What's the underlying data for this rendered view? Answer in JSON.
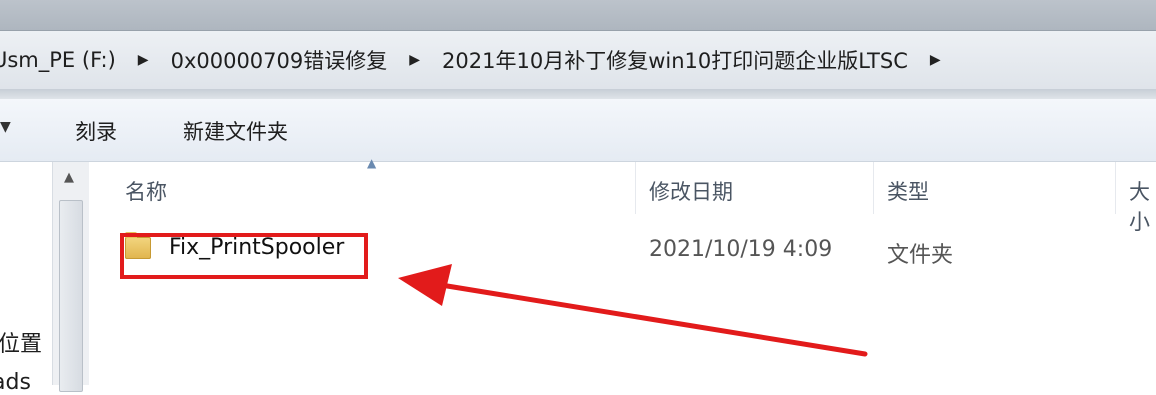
{
  "address_bar": {
    "crumbs": [
      "Usm_PE (F:)",
      "0x00000709错误修复",
      "2021年10月补丁修复win10打印问题企业版LTSC"
    ],
    "separator": "▶"
  },
  "toolbar": {
    "burn_label": "刻录",
    "new_folder_label": "新建文件夹"
  },
  "nav_pane": {
    "items": [
      "位置",
      "ads"
    ]
  },
  "columns": {
    "name": "名称",
    "date_modified": "修改日期",
    "type": "类型",
    "size": "大小"
  },
  "files": [
    {
      "name": "Fix_PrintSpooler",
      "date_modified": "2021/10/19 4:09",
      "type": "文件夹",
      "icon": "folder-icon"
    }
  ],
  "colors": {
    "annotation": "#e21b1b",
    "folder": "#e0b44c"
  }
}
